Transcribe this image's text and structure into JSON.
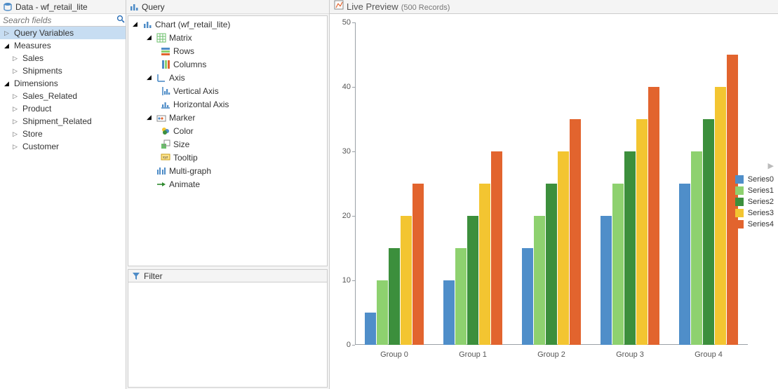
{
  "data_panel": {
    "title": "Data - wf_retail_lite",
    "search_placeholder": "Search fields",
    "tree": {
      "query_variables": "Query Variables",
      "measures": "Measures",
      "sales": "Sales",
      "shipments": "Shipments",
      "dimensions": "Dimensions",
      "sales_related": "Sales_Related",
      "product": "Product",
      "shipment_related": "Shipment_Related",
      "store": "Store",
      "customer": "Customer"
    }
  },
  "query_panel": {
    "title": "Query",
    "tree": {
      "chart": "Chart (wf_retail_lite)",
      "matrix": "Matrix",
      "rows": "Rows",
      "columns": "Columns",
      "axis": "Axis",
      "vaxis": "Vertical Axis",
      "haxis": "Horizontal Axis",
      "marker": "Marker",
      "color": "Color",
      "size": "Size",
      "tooltip": "Tooltip",
      "multigraph": "Multi-graph",
      "animate": "Animate"
    },
    "filter": {
      "title": "Filter"
    }
  },
  "preview": {
    "title": "Live Preview",
    "subtitle": "(500 Records)"
  },
  "chart_data": {
    "type": "bar",
    "categories": [
      "Group 0",
      "Group 1",
      "Group 2",
      "Group 3",
      "Group 4"
    ],
    "series": [
      {
        "name": "Series0",
        "color": "#4f8ec9",
        "values": [
          5,
          10,
          15,
          20,
          25
        ]
      },
      {
        "name": "Series1",
        "color": "#8ed16f",
        "values": [
          10,
          15,
          20,
          25,
          30
        ]
      },
      {
        "name": "Series2",
        "color": "#3c8f3c",
        "values": [
          15,
          20,
          25,
          30,
          35
        ]
      },
      {
        "name": "Series3",
        "color": "#f3c531",
        "values": [
          20,
          25,
          30,
          35,
          40
        ]
      },
      {
        "name": "Series4",
        "color": "#e2642e",
        "values": [
          25,
          30,
          35,
          40,
          45
        ]
      }
    ],
    "ylim": [
      0,
      50
    ],
    "yticks": [
      0,
      10,
      20,
      30,
      40,
      50
    ],
    "title": "",
    "xlabel": "",
    "ylabel": ""
  }
}
